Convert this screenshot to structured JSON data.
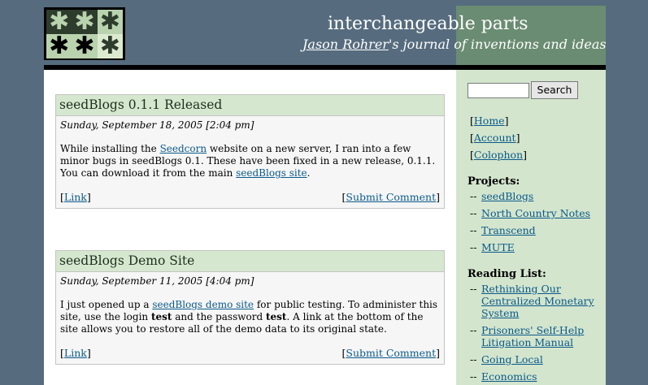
{
  "header": {
    "title": "interchangeable parts",
    "author_link": "Jason Rohrer",
    "subtitle_rest": "'s journal of inventions and ideas",
    "logo_glyph": "✱"
  },
  "colors": {
    "background": "#566c7e",
    "green_band": "#6a8c72",
    "sidebar": "#d3e5cd",
    "post_header": "#d5e8cf",
    "link": "#0b5a8a"
  },
  "posts": [
    {
      "title": "seedBlogs 0.1.1 Released",
      "date": "Sunday, September 18, 2005 [2:04 pm]",
      "body": {
        "t1": "While installing the ",
        "l1": "Seedcorn",
        "t2": " website on a new server, I ran into a few minor bugs in seedBlogs 0.1. These have been fixed in a new release, 0.1.1. You can download it from the main ",
        "l2": "seedBlogs site",
        "t3": "."
      },
      "link_label": "Link",
      "comment_label": "Submit Comment"
    },
    {
      "title": "seedBlogs Demo Site",
      "date": "Sunday, September 11, 2005 [4:04 pm]",
      "body": {
        "t1": "I just opened up a ",
        "l1": "seedBlogs demo site",
        "t2": " for public testing. To administer this site, use the login ",
        "b1": "test",
        "t3": " and the password ",
        "b2": "test",
        "t4": ". A link at the bottom of the site allows you to restore all of the demo data to its original state."
      },
      "link_label": "Link",
      "comment_label": "Submit Comment"
    }
  ],
  "sidebar": {
    "search_button": "Search",
    "search_value": "",
    "nav": [
      "Home",
      "Account",
      "Colophon"
    ],
    "projects_heading": "Projects:",
    "projects": [
      "seedBlogs",
      "North Country Notes",
      "Transcend",
      "MUTE"
    ],
    "reading_heading": "Reading List:",
    "reading": [
      "Rethinking Our Centralized Monetary System",
      "Prisoners' Self-Help Litigation Manual",
      "Going Local",
      "Economics"
    ]
  }
}
